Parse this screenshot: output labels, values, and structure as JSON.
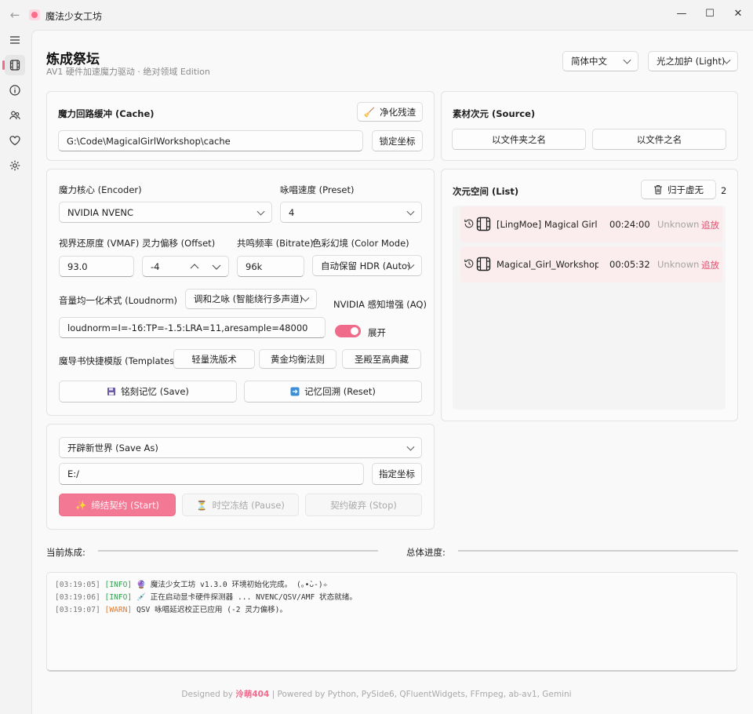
{
  "window": {
    "title": "魔法少女工坊",
    "controls": {
      "minimize": "—",
      "maximize": "☐",
      "close": "✕"
    }
  },
  "header": {
    "title": "炼成祭坛",
    "subtitle": "AV1 硬件加速魔力驱动 · 绝对领域 Edition",
    "language": "简体中文",
    "theme": "光之加护 (Light)"
  },
  "cache": {
    "label": "魔力回路缓冲 (Cache)",
    "clean_button": "净化残渣",
    "path": "G:\\Code\\MagicalGirlWorkshop\\cache",
    "lock_button": "锁定坐标"
  },
  "source": {
    "label": "素材次元 (Source)",
    "folder_button": "以文件夹之名",
    "file_button": "以文件之名"
  },
  "encoder": {
    "encoder_label": "魔力核心 (Encoder)",
    "encoder_value": "NVIDIA NVENC",
    "preset_label": "咏唱速度 (Preset)",
    "preset_value": "4",
    "vmaf_label": "视界还原度 (VMAF)",
    "vmaf_value": "93.0",
    "offset_label": "灵力偏移 (Offset)",
    "offset_value": "-4",
    "bitrate_label": "共鸣频率 (Bitrate)",
    "bitrate_value": "96k",
    "color_label": "色彩幻境 (Color Mode)",
    "color_value": "自动保留 HDR (Auto)",
    "loudnorm_label": "音量均一化术式 (Loudnorm)",
    "loudnorm_mode": "调和之咏 (智能绕行多声道)",
    "loudnorm_value": "loudnorm=I=-16:TP=-1.5:LRA=11,aresample=48000",
    "aq_label": "NVIDIA 感知增强 (AQ)",
    "aq_state": "展开",
    "templates_label": "魔导书快捷模版 (Templates):",
    "template_1": "轻量洗版术",
    "template_2": "黄金均衡法则",
    "template_3": "圣殿至高典藏",
    "save_button": "铭刻记忆 (Save)",
    "reset_button": "记忆回溯 (Reset)"
  },
  "list": {
    "label": "次元空间 (List)",
    "clear_button": "归于虚无",
    "count": "2",
    "items": [
      {
        "name": "[LingMoe] Magical Girl AV1",
        "duration": "00:24:00",
        "status": "Unknown",
        "action": "追放"
      },
      {
        "name": "Magical_Girl_Workshop_v1",
        "duration": "00:05:32",
        "status": "Unknown",
        "action": "追放"
      }
    ]
  },
  "output": {
    "mode": "开辟新世界 (Save As)",
    "path": "E:/",
    "path_button": "指定坐标",
    "start_button": "缔结契约 (Start)",
    "pause_button": "时空冻结 (Pause)",
    "stop_button": "契约破弃 (Stop)"
  },
  "progress": {
    "current_label": "当前炼成:",
    "total_label": "总体进度:"
  },
  "log": [
    {
      "time": "[03:19:05]",
      "level": "[INFO]",
      "emoji": "🔮",
      "text": "魔法少女工坊 v1.3.0 环境初始化完成。 (｡•̀ᴗ-)✧"
    },
    {
      "time": "[03:19:06]",
      "level": "[INFO]",
      "emoji": "💉",
      "text": "正在启动显卡硬件探测器 ... NVENC/QSV/AMF 状态就绪。"
    },
    {
      "time": "[03:19:07]",
      "level": "[WARN]",
      "emoji": "",
      "text": "QSV 咏唱延迟校正已应用 (-2 灵力偏移)。"
    }
  ],
  "footer": {
    "prefix": "Designed by",
    "author": "泠萌404",
    "suffix": "| Powered by Python, PySide6, QFluentWidgets, FFmpeg, ab-av1, Gemini"
  },
  "colors": {
    "accent": "#f06a8a",
    "list_item_bg": "#fbecee",
    "info": "#2da44e",
    "warn": "#e07a2d"
  },
  "icons": {
    "back": "arrow-left-icon",
    "nav": [
      "menu-icon",
      "film-icon",
      "info-icon",
      "people-icon",
      "heart-icon",
      "gear-icon"
    ],
    "clean": "broom-icon",
    "save": "floppy-icon",
    "reset": "restore-icon",
    "clear": "trash-icon",
    "start": "sparkle-icon",
    "pause": "hourglass-icon"
  }
}
